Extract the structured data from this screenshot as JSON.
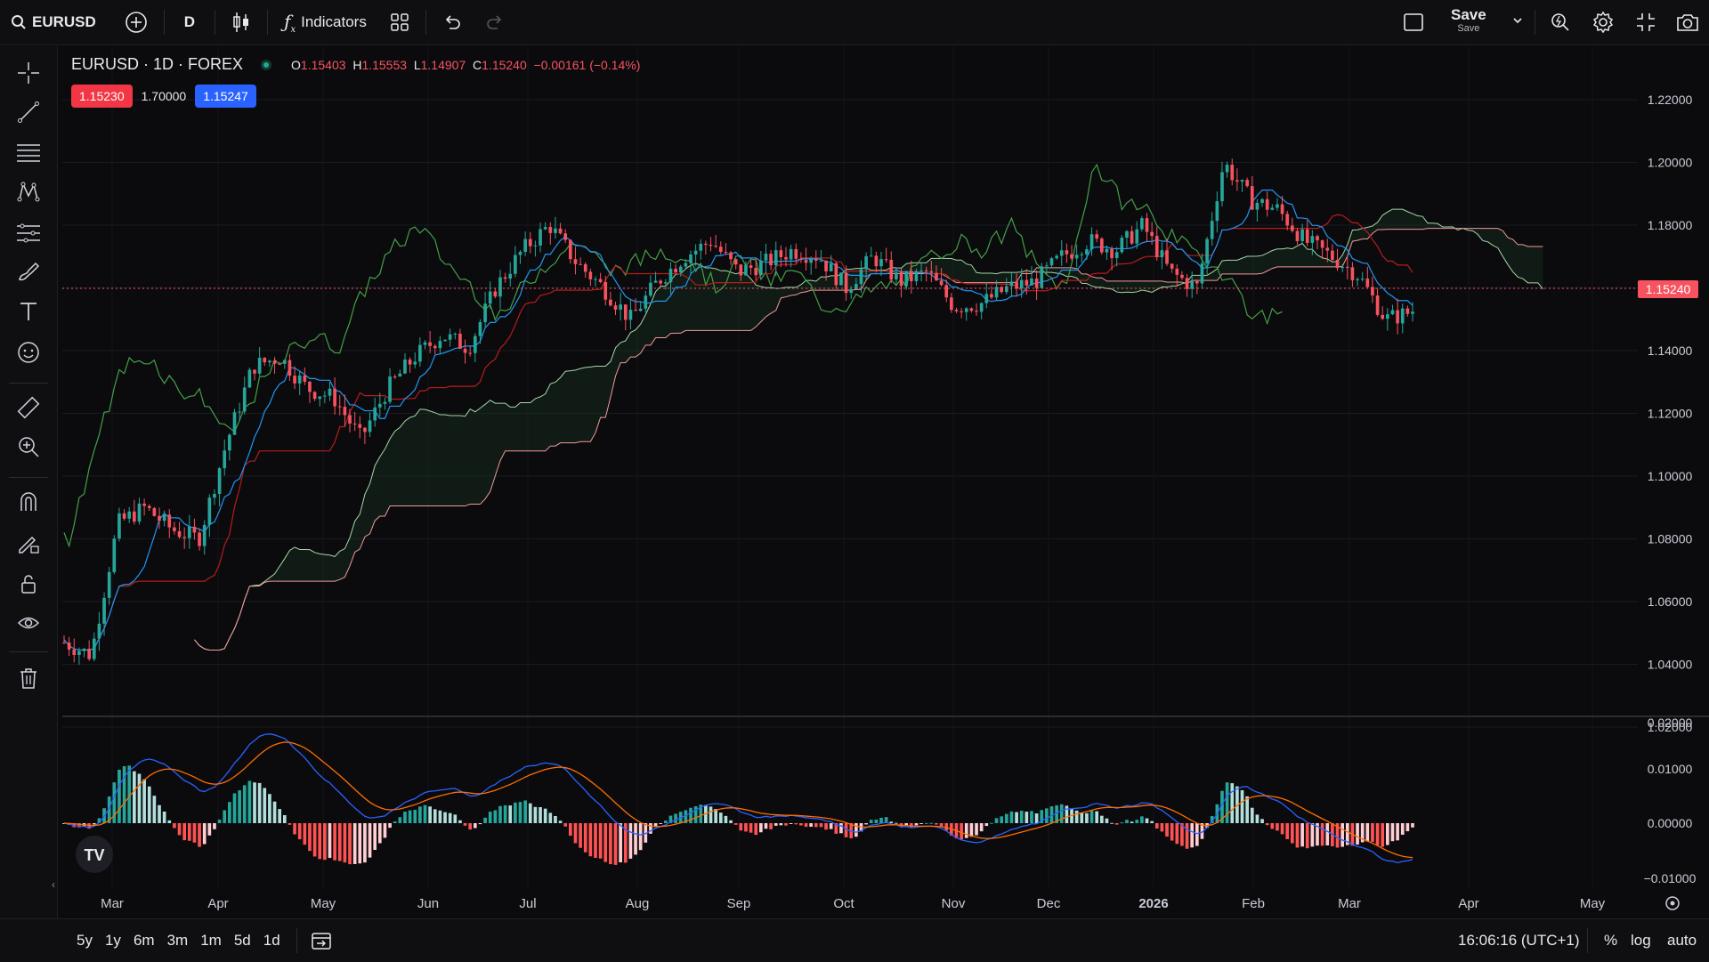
{
  "toolbar": {
    "symbol": "EURUSD",
    "interval": "D",
    "indicators_label": "Indicators",
    "save_label": "Save",
    "save_sub": "Save"
  },
  "legend": {
    "title": "EURUSD · 1D · FOREX",
    "open_label": "O",
    "open": "1.15403",
    "high_label": "H",
    "high": "1.15553",
    "low_label": "L",
    "low": "1.14907",
    "close_label": "C",
    "close": "1.15240",
    "change": "−0.00161 (−0.14%)",
    "bid": "1.15230",
    "spread": "1.70000",
    "ask": "1.15247"
  },
  "price_axis": {
    "ticks": [
      "1.22000",
      "1.20000",
      "1.18000",
      "1.16000",
      "1.14000",
      "1.12000",
      "1.10000",
      "1.08000",
      "1.06000",
      "1.04000",
      "1.02000"
    ],
    "current_price": "1.15240"
  },
  "macd_axis": {
    "ticks": [
      "0.02000",
      "0.01000",
      "0.00000",
      "−0.01000"
    ]
  },
  "time_axis": {
    "labels": [
      "Mar",
      "Apr",
      "May",
      "Jun",
      "Jul",
      "Aug",
      "Sep",
      "Oct",
      "Nov",
      "Dec",
      "2026",
      "Feb",
      "Mar",
      "Apr",
      "May"
    ]
  },
  "bottom": {
    "ranges": [
      "5y",
      "1y",
      "6m",
      "3m",
      "1m",
      "5d",
      "1d"
    ],
    "clock": "16:06:16 (UTC+1)",
    "percent": "%",
    "log": "log",
    "auto": "auto"
  },
  "colors": {
    "up": "#26a69a",
    "down": "#f7525f",
    "macd": "#2962ff",
    "signal": "#ff6d00",
    "background": "#0b0b0e"
  },
  "chart_data": {
    "type": "candlestick",
    "title": "EURUSD · 1D · FOREX",
    "x_range": [
      "2025-02-24",
      "2026-03-18"
    ],
    "ylim": [
      1.02,
      1.22
    ],
    "close_path": [
      1.047,
      1.043,
      1.085,
      1.09,
      1.083,
      1.08,
      1.11,
      1.135,
      1.138,
      1.128,
      1.125,
      1.112,
      1.128,
      1.138,
      1.145,
      1.141,
      1.16,
      1.172,
      1.18,
      1.168,
      1.16,
      1.15,
      1.162,
      1.17,
      1.175,
      1.165,
      1.168,
      1.172,
      1.17,
      1.16,
      1.17,
      1.162,
      1.165,
      1.154,
      1.155,
      1.16,
      1.162,
      1.17,
      1.175,
      1.172,
      1.18,
      1.165,
      1.16,
      1.2,
      1.188,
      1.185,
      1.175,
      1.17,
      1.164,
      1.15,
      1.1524
    ],
    "indicators": [
      "Ichimoku Cloud",
      "MACD"
    ]
  }
}
